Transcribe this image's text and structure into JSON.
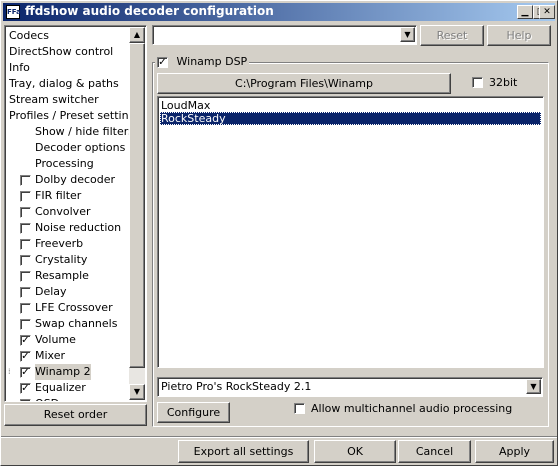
{
  "window": {
    "title": "ffdshow audio decoder configuration",
    "icon_text": "FFa",
    "controls": [
      "minimize",
      "maximize",
      "close"
    ]
  },
  "tree": {
    "items": [
      {
        "label": "Codecs",
        "indent": 0,
        "checkbox": null
      },
      {
        "label": "DirectShow control",
        "indent": 0,
        "checkbox": null
      },
      {
        "label": "Info",
        "indent": 0,
        "checkbox": null
      },
      {
        "label": "Tray, dialog & paths",
        "indent": 0,
        "checkbox": null
      },
      {
        "label": "Stream switcher",
        "indent": 0,
        "checkbox": null
      },
      {
        "label": "Profiles / Preset settings",
        "indent": 0,
        "checkbox": null
      },
      {
        "label": "Show / hide filters",
        "indent": 1,
        "checkbox": null
      },
      {
        "label": "Decoder options",
        "indent": 1,
        "checkbox": null
      },
      {
        "label": "Processing",
        "indent": 1,
        "checkbox": null
      },
      {
        "label": "Dolby decoder",
        "indent": 1,
        "checkbox": false
      },
      {
        "label": "FIR filter",
        "indent": 1,
        "checkbox": false
      },
      {
        "label": "Convolver",
        "indent": 1,
        "checkbox": false
      },
      {
        "label": "Noise reduction",
        "indent": 1,
        "checkbox": false
      },
      {
        "label": "Freeverb",
        "indent": 1,
        "checkbox": false
      },
      {
        "label": "Crystality",
        "indent": 1,
        "checkbox": false
      },
      {
        "label": "Resample",
        "indent": 1,
        "checkbox": false
      },
      {
        "label": "Delay",
        "indent": 1,
        "checkbox": false
      },
      {
        "label": "LFE Crossover",
        "indent": 1,
        "checkbox": false
      },
      {
        "label": "Swap channels",
        "indent": 1,
        "checkbox": false
      },
      {
        "label": "Volume",
        "indent": 1,
        "checkbox": true
      },
      {
        "label": "Mixer",
        "indent": 1,
        "checkbox": true
      },
      {
        "label": "Winamp 2",
        "indent": 1,
        "checkbox": true,
        "selected": true
      },
      {
        "label": "Equalizer",
        "indent": 1,
        "checkbox": true
      },
      {
        "label": "OSD",
        "indent": 1,
        "checkbox": false
      }
    ],
    "check_glyph": "✓"
  },
  "reset_order_label": "Reset order",
  "top": {
    "combo_value": "",
    "reset_label": "Reset",
    "help_label": "Help"
  },
  "winamp": {
    "enabled_label": "Winamp DSP",
    "enabled": true,
    "path_button": "C:\\Program Files\\Winamp",
    "bit32_label": "32bit",
    "bit32": false,
    "plugins": [
      "LoudMax",
      "RockSteady"
    ],
    "selected_plugin": "RockSteady",
    "module_value": "Pietro Pro's RockSteady 2.1",
    "configure_label": "Configure",
    "multichannel_label": "Allow multichannel audio processing",
    "multichannel": false
  },
  "footer": {
    "export_label": "Export all settings",
    "ok_label": "OK",
    "cancel_label": "Cancel",
    "apply_label": "Apply"
  }
}
